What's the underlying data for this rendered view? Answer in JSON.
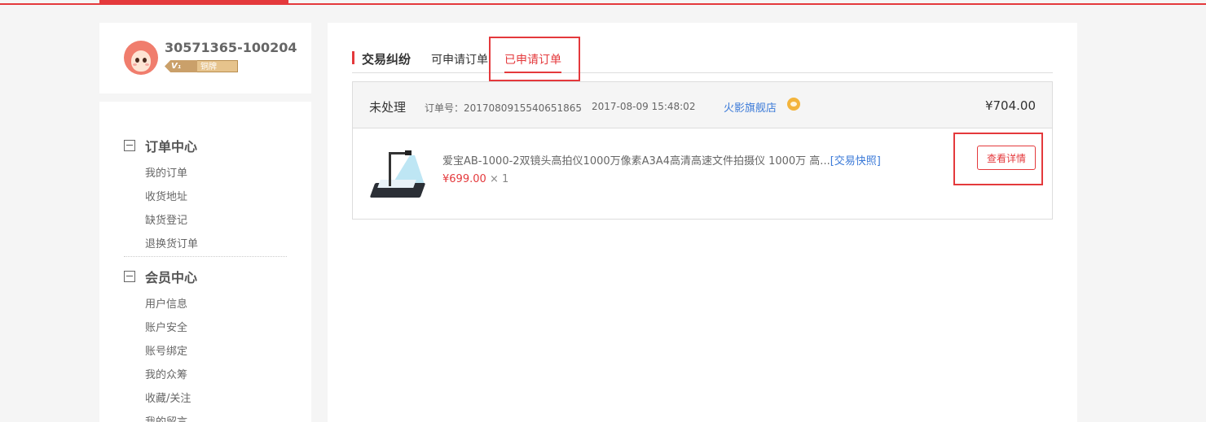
{
  "user": {
    "username": "30571365-100204",
    "level_prefix": "V₁",
    "level_name": "铜牌"
  },
  "sidebar": {
    "sections": [
      {
        "title": "订单中心",
        "items": [
          "我的订单",
          "收货地址",
          "缺货登记",
          "退换货订单"
        ]
      },
      {
        "title": "会员中心",
        "items": [
          "用户信息",
          "账户安全",
          "账号绑定",
          "我的众筹",
          "收藏/关注",
          "我的留言"
        ]
      }
    ]
  },
  "main": {
    "title": "交易纠纷",
    "tabs": [
      {
        "label": "可申请订单",
        "active": false
      },
      {
        "label": "已申请订单",
        "active": true
      }
    ],
    "order": {
      "status": "未处理",
      "order_no": "订单号：2017080915540651865",
      "time": "2017-08-09 15:48:02",
      "shop": "火影旗舰店",
      "total": "¥704.00",
      "product": {
        "name": "爱宝AB-1000-2双镜头高拍仪1000万像素A3A4高清高速文件拍摄仪 1000万 高...",
        "snapshot_label": "[交易快照]",
        "price": "¥699.00",
        "qty": "× 1"
      },
      "detail_button": "查看详情"
    }
  },
  "colors": {
    "accent": "#e4393c",
    "link": "#3b7ad8"
  }
}
